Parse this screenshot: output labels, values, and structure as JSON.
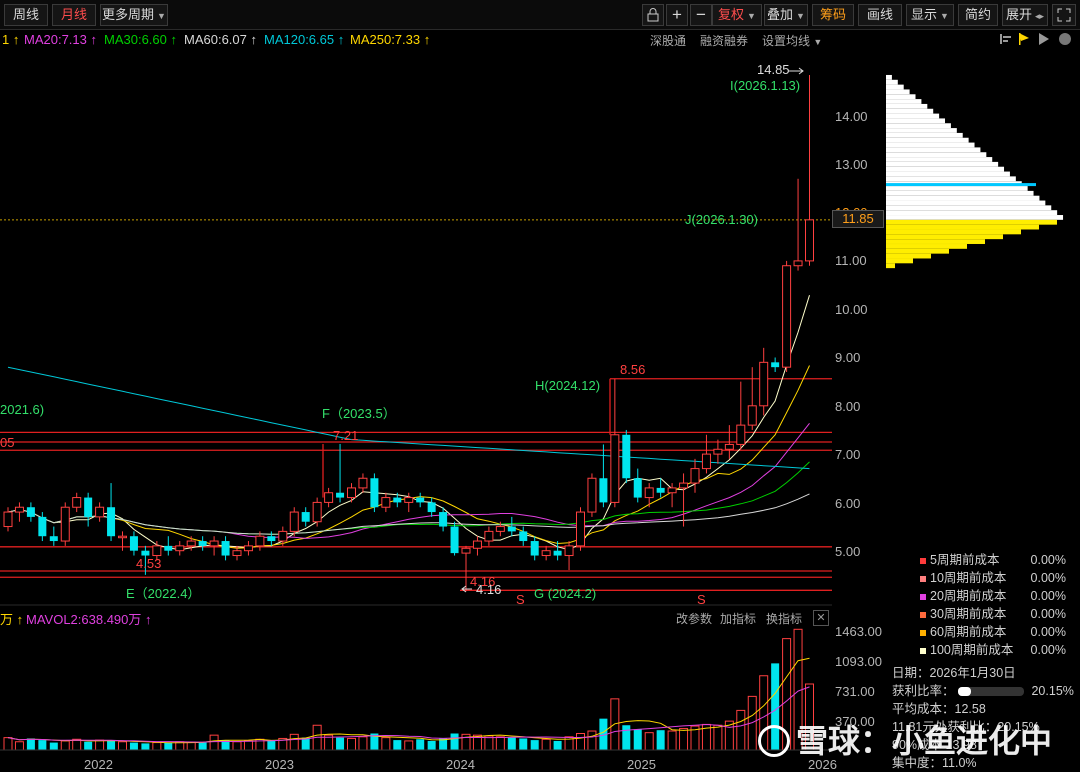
{
  "toolbar": {
    "week": "周线",
    "month": "月线",
    "more": "更多周期",
    "fq": "复权",
    "overlay": "叠加",
    "chips": "筹码",
    "draw": "画线",
    "display": "显示",
    "simple": "简约",
    "expand": "展开"
  },
  "ma": {
    "ma20": "MA20:7.13",
    "ma30": "MA30:6.60",
    "ma60": "MA60:6.07",
    "ma120": "MA120:6.65",
    "ma250": "MA250:7.33",
    "ma_first_partial": "1",
    "up_arrow": "↑"
  },
  "main_tools": {
    "hk": "深股通",
    "margin": "融资融券",
    "setma": "设置均线"
  },
  "annotations": {
    "high_price": "14.85",
    "I": "I(2026.1.13)",
    "J": "J(2026.1.30)",
    "H": "H(2024.12)",
    "H_price": "8.56",
    "F": "F（2023.5）",
    "F_price": "7.21",
    "left_label": "2021.6)",
    "left_price": "05",
    "E": "E（2022.4）",
    "E_price": "4.53",
    "G": "G (2024.2)",
    "G_price": "4.16",
    "G_price2": "4.16",
    "s_marker": "S",
    "current_price": "11.85"
  },
  "price_axis": [
    "14.00",
    "13.00",
    "12.00",
    "11.00",
    "10.00",
    "9.00",
    "8.00",
    "7.00",
    "6.00",
    "5.00"
  ],
  "vol_axis": [
    "1463.00",
    "1093.00",
    "731.00",
    "370.00"
  ],
  "vol_legend": {
    "partial": "万",
    "mavol2": "MAVOL2:638.490万",
    "up_arrow": "↑"
  },
  "vol_tools": {
    "params": "改参数",
    "add": "加指标",
    "switch": "换指标",
    "close": "✕"
  },
  "x_axis": [
    "2022",
    "2023",
    "2024",
    "2025",
    "2026"
  ],
  "cost_list": [
    {
      "label": "5周期前成本",
      "value": "0.00%",
      "color": "#ff3b3b"
    },
    {
      "label": "10周期前成本",
      "value": "0.00%",
      "color": "#ff7f7f"
    },
    {
      "label": "20周期前成本",
      "value": "0.00%",
      "color": "#e040e0"
    },
    {
      "label": "30周期前成本",
      "value": "0.00%",
      "color": "#ff6a3d"
    },
    {
      "label": "60周期前成本",
      "value": "0.00%",
      "color": "#ffb000"
    },
    {
      "label": "100周期前成本",
      "value": "0.00%",
      "color": "#ffffcc"
    }
  ],
  "chip_stats": {
    "date_label": "日期：",
    "date": "2026年1月30日",
    "profit_label": "获利比率：",
    "profit": "20.15%",
    "profit_frac": 0.2015,
    "avg_label": "平均成本：",
    "avg": "12.58",
    "line4": "11.81元处获利比：20.15%",
    "line5_a": "90%成本",
    "line5_b": "13.98",
    "conc_label": "集中度：",
    "conc": "11.0%"
  },
  "watermark": "雪球：小鱼进化中",
  "colors": {
    "up": "#ff4040",
    "down": "#00e5ee",
    "ma20": "#e040e0",
    "ma30": "#00d000",
    "ma60": "#d8d8d8",
    "ma120": "#00c8d8",
    "ma250": "#ffd700",
    "support": "#e02020"
  },
  "chart_data": {
    "type": "candlestick",
    "price_range": [
      4.0,
      15.0
    ],
    "candles": [
      [
        5.5,
        5.9,
        5.4,
        5.8
      ],
      [
        5.8,
        6.0,
        5.6,
        5.9
      ],
      [
        5.9,
        6.0,
        5.6,
        5.7
      ],
      [
        5.7,
        5.8,
        5.2,
        5.3
      ],
      [
        5.3,
        5.5,
        5.1,
        5.2
      ],
      [
        5.2,
        6.0,
        5.1,
        5.9
      ],
      [
        5.9,
        6.2,
        5.8,
        6.1
      ],
      [
        6.1,
        6.2,
        5.5,
        5.7
      ],
      [
        5.7,
        6.0,
        5.6,
        5.9
      ],
      [
        5.9,
        6.4,
        5.2,
        5.3
      ],
      [
        5.3,
        5.4,
        5.0,
        5.3
      ],
      [
        5.3,
        5.4,
        4.9,
        5.0
      ],
      [
        5.0,
        5.1,
        4.5,
        4.9
      ],
      [
        4.9,
        5.2,
        4.8,
        5.1
      ],
      [
        5.1,
        5.3,
        4.9,
        5.0
      ],
      [
        5.0,
        5.2,
        4.9,
        5.1
      ],
      [
        5.1,
        5.3,
        5.0,
        5.2
      ],
      [
        5.2,
        5.3,
        5.0,
        5.1
      ],
      [
        5.1,
        5.3,
        4.9,
        5.2
      ],
      [
        5.2,
        5.3,
        4.8,
        4.9
      ],
      [
        4.9,
        5.1,
        4.8,
        5.0
      ],
      [
        5.0,
        5.2,
        4.9,
        5.1
      ],
      [
        5.1,
        5.4,
        5.0,
        5.3
      ],
      [
        5.3,
        5.4,
        5.1,
        5.2
      ],
      [
        5.2,
        5.5,
        5.1,
        5.4
      ],
      [
        5.4,
        5.9,
        5.3,
        5.8
      ],
      [
        5.8,
        5.9,
        5.5,
        5.6
      ],
      [
        5.6,
        6.1,
        5.5,
        6.0
      ],
      [
        6.0,
        6.3,
        5.9,
        6.2
      ],
      [
        6.2,
        7.21,
        6.0,
        6.1
      ],
      [
        6.1,
        6.4,
        6.0,
        6.3
      ],
      [
        6.3,
        6.6,
        6.2,
        6.5
      ],
      [
        6.5,
        6.6,
        5.8,
        5.9
      ],
      [
        5.9,
        6.2,
        5.8,
        6.1
      ],
      [
        6.1,
        6.2,
        5.9,
        6.0
      ],
      [
        6.0,
        6.2,
        5.8,
        6.1
      ],
      [
        6.1,
        6.2,
        5.9,
        6.0
      ],
      [
        6.0,
        6.1,
        5.7,
        5.8
      ],
      [
        5.8,
        5.9,
        5.4,
        5.5
      ],
      [
        5.5,
        5.6,
        4.9,
        4.95
      ],
      [
        4.95,
        5.1,
        4.16,
        5.05
      ],
      [
        5.05,
        5.3,
        4.9,
        5.2
      ],
      [
        5.2,
        5.5,
        5.1,
        5.4
      ],
      [
        5.4,
        5.6,
        5.3,
        5.5
      ],
      [
        5.5,
        5.7,
        5.3,
        5.4
      ],
      [
        5.4,
        5.5,
        5.1,
        5.2
      ],
      [
        5.2,
        5.3,
        4.8,
        4.9
      ],
      [
        4.9,
        5.1,
        4.8,
        5.0
      ],
      [
        5.0,
        5.2,
        4.8,
        4.9
      ],
      [
        4.9,
        5.2,
        4.6,
        5.1
      ],
      [
        5.1,
        5.9,
        5.0,
        5.8
      ],
      [
        5.8,
        6.6,
        5.7,
        6.5
      ],
      [
        6.5,
        7.2,
        5.9,
        6.0
      ],
      [
        6.0,
        8.56,
        5.9,
        7.4
      ],
      [
        7.4,
        7.5,
        6.4,
        6.5
      ],
      [
        6.5,
        6.7,
        6.0,
        6.1
      ],
      [
        6.1,
        6.4,
        5.9,
        6.3
      ],
      [
        6.3,
        6.5,
        6.1,
        6.2
      ],
      [
        6.2,
        6.4,
        5.9,
        6.3
      ],
      [
        6.3,
        6.6,
        5.5,
        6.4
      ],
      [
        6.4,
        6.9,
        6.2,
        6.7
      ],
      [
        6.7,
        7.4,
        6.6,
        7.0
      ],
      [
        7.0,
        7.3,
        6.8,
        7.1
      ],
      [
        7.1,
        7.6,
        6.9,
        7.2
      ],
      [
        7.2,
        8.5,
        7.1,
        7.6
      ],
      [
        7.6,
        8.8,
        7.5,
        8.0
      ],
      [
        8.0,
        9.2,
        7.8,
        8.9
      ],
      [
        8.9,
        9.0,
        8.7,
        8.8
      ],
      [
        8.8,
        11.0,
        8.7,
        10.9
      ],
      [
        10.9,
        12.7,
        10.8,
        11.0
      ],
      [
        11.0,
        14.85,
        10.9,
        11.85
      ]
    ],
    "volumes_wan": [
      150,
      100,
      140,
      120,
      90,
      110,
      130,
      100,
      120,
      110,
      100,
      90,
      80,
      90,
      85,
      100,
      95,
      90,
      180,
      120,
      100,
      110,
      130,
      120,
      140,
      190,
      150,
      300,
      180,
      150,
      140,
      160,
      200,
      150,
      120,
      110,
      130,
      110,
      140,
      200,
      190,
      180,
      170,
      160,
      150,
      140,
      120,
      130,
      110,
      160,
      200,
      230,
      380,
      620,
      300,
      250,
      210,
      240,
      230,
      260,
      290,
      310,
      300,
      350,
      480,
      650,
      900,
      1050,
      1350,
      1463,
      800
    ]
  }
}
